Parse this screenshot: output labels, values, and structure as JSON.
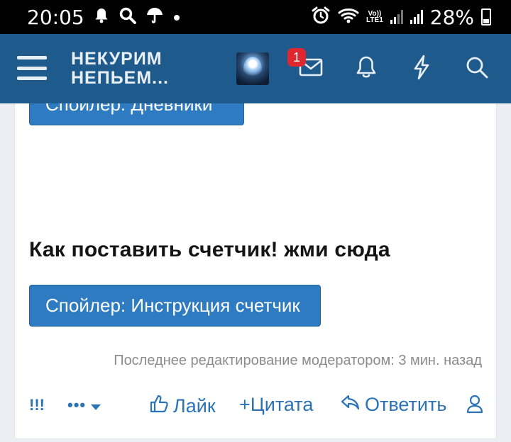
{
  "status_bar": {
    "time": "20:05",
    "left_icons": [
      "bell-icon",
      "search-icon",
      "umbrella-icon",
      "dot-icon"
    ],
    "right_icons": [
      "alarm-icon",
      "wifi-icon",
      "volte-icon",
      "signal-icon",
      "signal-icon"
    ],
    "volte_label": "Vo))",
    "lte_label": "LTE1",
    "battery": "28%"
  },
  "header": {
    "logo_line1": "НЕКУРИМ",
    "logo_line2": "НЕПЬЕМ...",
    "inbox_badge": "1",
    "icons": [
      "menu-icon",
      "avatar",
      "inbox-icon",
      "bell-icon",
      "lightning-icon",
      "search-icon"
    ]
  },
  "post": {
    "spoiler_top_label": "Спойлер: Дневники",
    "heading": "Как поставить счетчик! жми сюда",
    "spoiler_instr_label": "Спойлер: Инструкция счетчик",
    "edited_note": "Последнее редактирование модератором: 3 мин. назад"
  },
  "actions": {
    "bangs": "!!!",
    "more_dots": "•••",
    "like": "Лайк",
    "quote": "+Цитата",
    "reply": "Ответить"
  },
  "colors": {
    "header_bg": "#1f5a8c",
    "accent_blue": "#2e7bc1",
    "link_blue": "#2b73b6",
    "badge_red": "#e0262e"
  }
}
